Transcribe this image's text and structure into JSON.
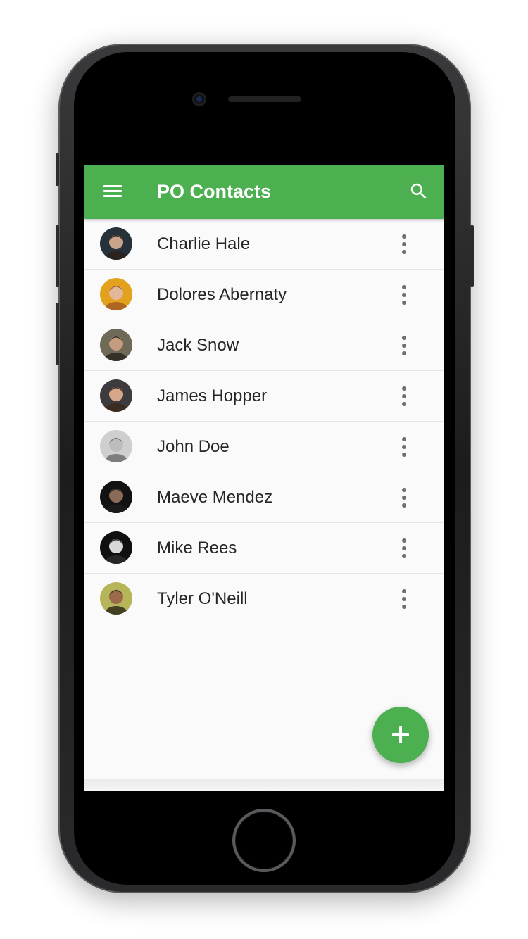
{
  "app": {
    "title": "PO Contacts",
    "accent_color": "#4caf50"
  },
  "appbar": {
    "menu_icon": "hamburger-menu-icon",
    "search_icon": "search-icon"
  },
  "contacts": [
    {
      "name": "Charlie Hale",
      "avatar_bg": "#27313a",
      "skin": "#c9a48a",
      "hair": "#2b2018"
    },
    {
      "name": "Dolores Abernaty",
      "avatar_bg": "#e3a21e",
      "skin": "#e2b79a",
      "hair": "#a55a22"
    },
    {
      "name": "Jack Snow",
      "avatar_bg": "#6f6a58",
      "skin": "#c69c80",
      "hair": "#2a2622"
    },
    {
      "name": "James Hopper",
      "avatar_bg": "#3d3b3e",
      "skin": "#d7a78a",
      "hair": "#3b2a1e"
    },
    {
      "name": "John Doe",
      "avatar_bg": "#cfcfcf",
      "skin": "#bdbdbd",
      "hair": "#6e6e6e"
    },
    {
      "name": "Maeve Mendez",
      "avatar_bg": "#121212",
      "skin": "#8a6a58",
      "hair": "#1c1c1c"
    },
    {
      "name": "Mike Rees",
      "avatar_bg": "#101010",
      "skin": "#d8d8d8",
      "hair": "#2a2a2a"
    },
    {
      "name": "Tyler O'Neill",
      "avatar_bg": "#b7b55a",
      "skin": "#9a6a4a",
      "hair": "#2f2a1a"
    }
  ],
  "row_menu_icon": "more-vertical-icon",
  "fab": {
    "icon": "plus-icon"
  }
}
